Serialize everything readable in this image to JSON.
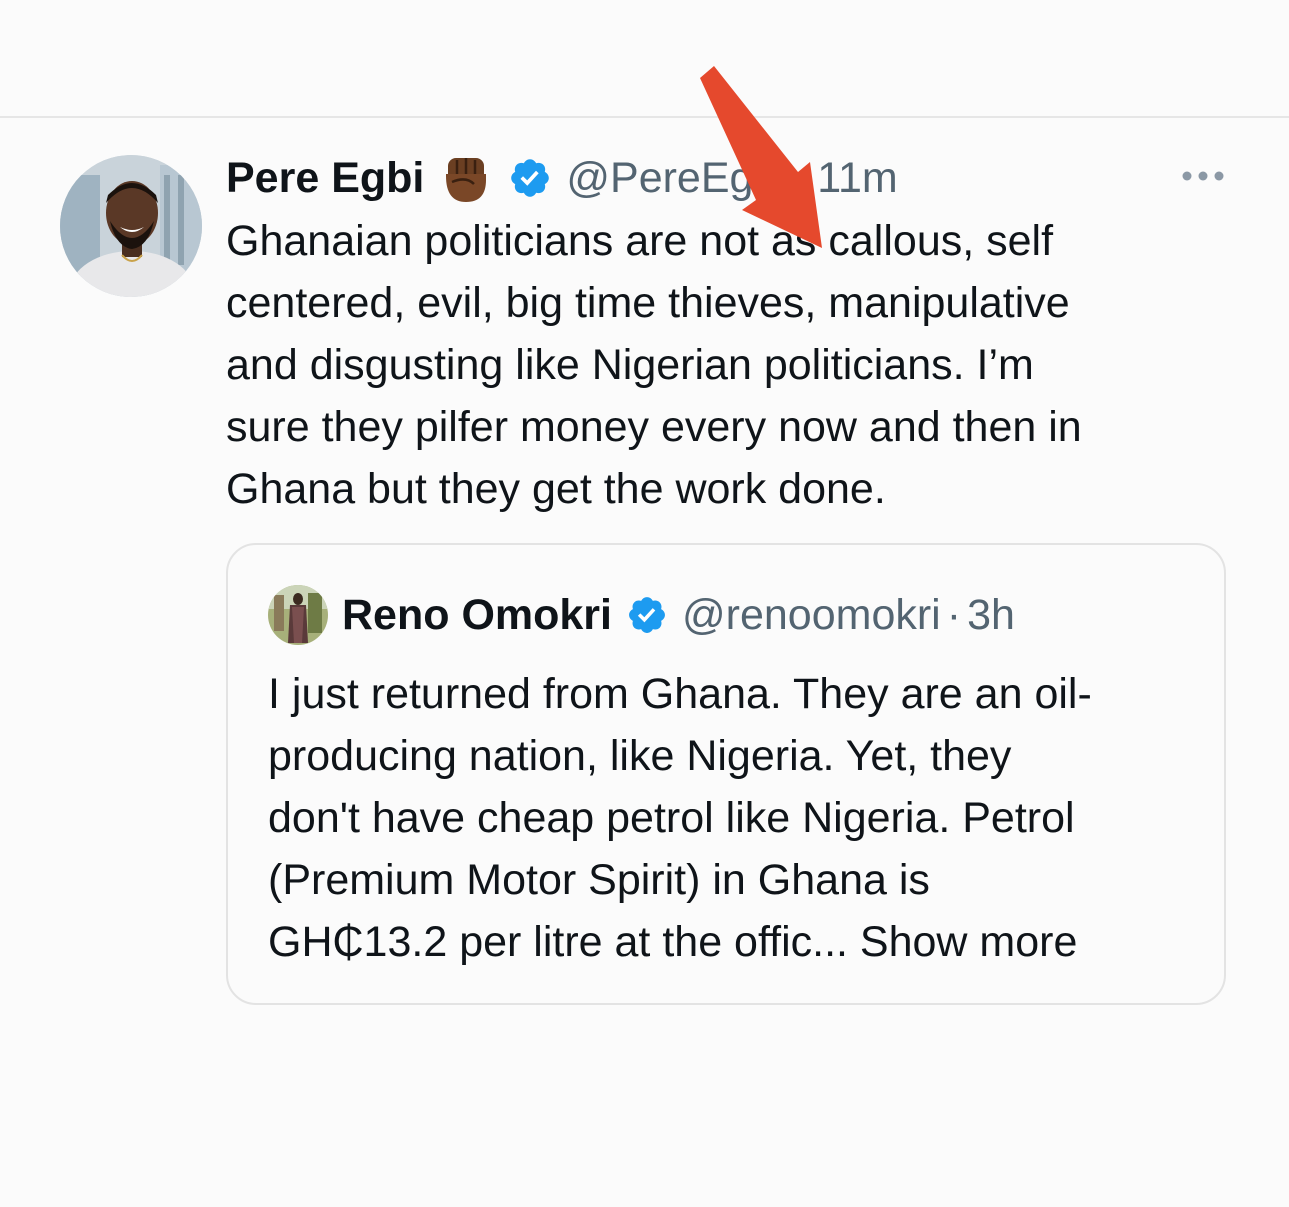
{
  "tweet": {
    "author_name": "Pere Egbi",
    "author_emoji": "✊🏾",
    "handle": "@PereEgbi",
    "separator": "·",
    "time": "11m",
    "text": "Ghanaian politicians are not as callous, self\ncentered, evil, big time thieves, manipulative\nand disgusting like Nigerian politicians. I’m\nsure they pilfer money every now and then in\nGhana but they get the work done."
  },
  "quoted_tweet": {
    "author_name": "Reno Omokri",
    "handle": "@renoomokri",
    "separator": "·",
    "time": "3h",
    "text": "I just returned from Ghana. They are an oil-\nproducing nation, like Nigeria. Yet, they\ndon't have cheap petrol like Nigeria. Petrol\n(Premium Motor Spirit) in Ghana is\nGH₵13.2 per litre at the offic... ",
    "show_more": "Show more"
  },
  "icons": {
    "more": "more-horizontal-icon",
    "verified": "verified-badge-icon",
    "annotation": "red-arrow-annotation"
  },
  "colors": {
    "verified_blue": "#1d9bf0",
    "secondary_text": "#536471",
    "arrow_red": "#e5492d"
  }
}
